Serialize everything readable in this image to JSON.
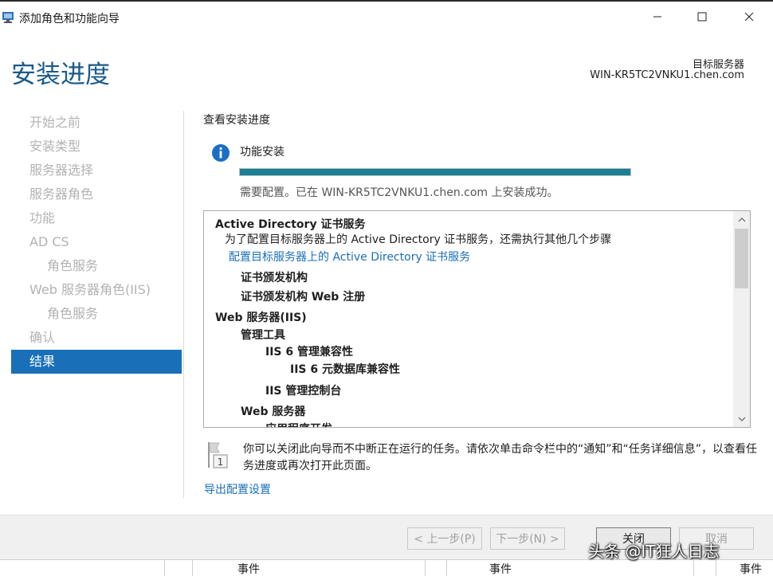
{
  "window": {
    "title": "添加角色和功能向导",
    "minimize_label": "—",
    "maximize_label": "☐",
    "close_label": "✕"
  },
  "header": {
    "page_title": "安装进度",
    "destination_label": "目标服务器",
    "destination_value": "WIN-KR5TC2VNKU1.chen.com"
  },
  "sidebar": {
    "items": [
      {
        "label": "开始之前"
      },
      {
        "label": "安装类型"
      },
      {
        "label": "服务器选择"
      },
      {
        "label": "服务器角色"
      },
      {
        "label": "功能"
      },
      {
        "label": "AD CS"
      },
      {
        "label": "角色服务"
      },
      {
        "label": "Web 服务器角色(IIS)"
      },
      {
        "label": "角色服务"
      },
      {
        "label": "确认"
      },
      {
        "label": "结果"
      }
    ]
  },
  "main": {
    "section_title": "查看安装进度",
    "install_title": "功能安装",
    "progress": 1.0,
    "status_text": "需要配置。已在 WIN-KR5TC2VNKU1.chen.com 上安装成功。",
    "results": {
      "adcs_heading": "Active Directory 证书服务",
      "adcs_note": "为了配置目标服务器上的 Active Directory 证书服务，还需执行其他几个步骤",
      "adcs_link": "配置目标服务器上的 Active Directory 证书服务",
      "ca": "证书颁发机构",
      "ca_web": "证书颁发机构 Web 注册",
      "iis_heading": "Web 服务器(IIS)",
      "mgmt_tools": "管理工具",
      "iis6_compat": "IIS 6 管理兼容性",
      "iis6_metabase": "IIS 6 元数据库兼容性",
      "iis_console": "IIS 管理控制台",
      "web_server": "Web 服务器",
      "app_dev": "应用程序开发"
    },
    "note_text": "你可以关闭此向导而不中断正在运行的任务。请依次单击命令栏中的“通知”和“任务详细信息”，以查看任务进度或再次打开此页面。",
    "export_link": "导出配置设置"
  },
  "footer": {
    "prev_label": "< 上一步(P)",
    "next_label": "下一步(N) >",
    "close_label": "关闭",
    "cancel_label": "取消"
  },
  "bottom_strip": {
    "col1": "事件",
    "col2": "事件",
    "col3": "事件"
  },
  "watermark": "头条 @IT狂人日志"
}
